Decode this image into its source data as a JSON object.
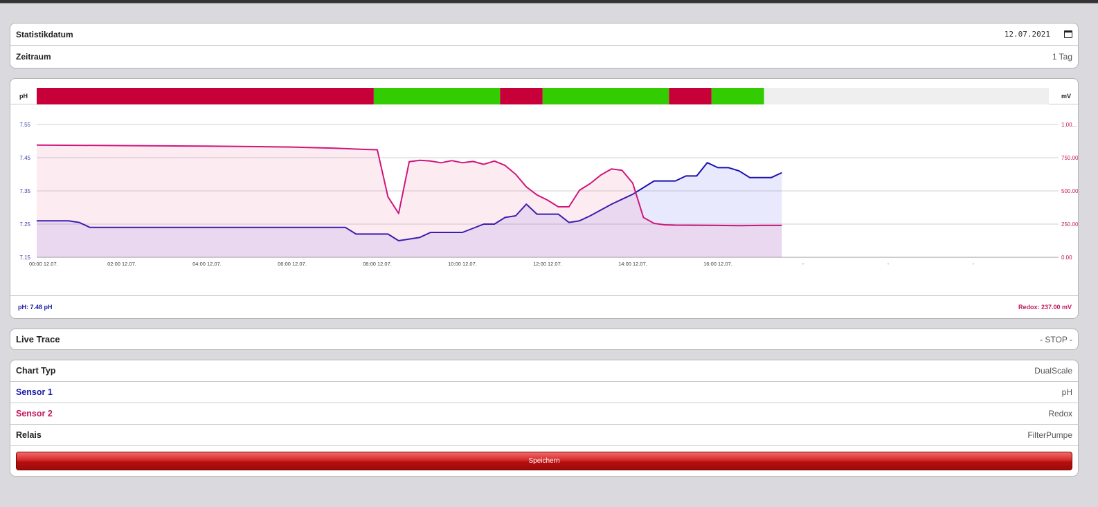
{
  "stats": {
    "date_label": "Statistikdatum",
    "date_value": "12.07.2021",
    "period_label": "Zeitraum",
    "period_value": "1 Tag"
  },
  "chart_header": {
    "left_unit": "pH",
    "right_unit": "mV"
  },
  "relay_segments": [
    {
      "state": "off",
      "color": "#c8003a",
      "from": "00:00",
      "to": "07:55"
    },
    {
      "state": "on",
      "color": "#33cc00",
      "from": "07:55",
      "to": "10:53"
    },
    {
      "state": "off",
      "color": "#c8003a",
      "from": "10:53",
      "to": "11:53"
    },
    {
      "state": "on",
      "color": "#33cc00",
      "from": "11:53",
      "to": "14:51"
    },
    {
      "state": "off",
      "color": "#c8003a",
      "from": "14:51",
      "to": "15:51"
    },
    {
      "state": "on",
      "color": "#33cc00",
      "from": "15:51",
      "to": "17:05"
    }
  ],
  "chart_data": {
    "type": "line",
    "title": "",
    "x_ticks": [
      "00:00 12.07.",
      "02:00 12.07.",
      "04:00 12.07.",
      "06:00 12.07.",
      "08:00 12.07.",
      "10:00 12.07.",
      "12:00 12.07.",
      "14:00 12.07.",
      "16:00 12.07.",
      "-",
      "-",
      "-"
    ],
    "y_left": {
      "label": "pH",
      "ticks": [
        "7.55",
        "7.45",
        "7.35",
        "7.25",
        "7.15"
      ],
      "range": [
        7.15,
        7.55
      ]
    },
    "y_right": {
      "label": "mV",
      "ticks": [
        "1,00...",
        "750.00",
        "500.00",
        "250.00",
        "0.00"
      ],
      "range": [
        0,
        1000
      ]
    },
    "x_range_hours": [
      0,
      24
    ],
    "series": [
      {
        "name": "pH",
        "axis": "left",
        "color": "#1a0fb0",
        "fill": "rgba(110,110,240,0.15)",
        "points": [
          [
            0,
            7.26
          ],
          [
            0.5,
            7.26
          ],
          [
            0.75,
            7.26
          ],
          [
            1.0,
            7.255
          ],
          [
            1.25,
            7.24
          ],
          [
            2,
            7.24
          ],
          [
            4,
            7.24
          ],
          [
            6,
            7.24
          ],
          [
            7.25,
            7.24
          ],
          [
            7.5,
            7.22
          ],
          [
            8.25,
            7.22
          ],
          [
            8.5,
            7.2
          ],
          [
            9.0,
            7.21
          ],
          [
            9.25,
            7.225
          ],
          [
            10,
            7.225
          ],
          [
            10.5,
            7.25
          ],
          [
            10.75,
            7.25
          ],
          [
            11.0,
            7.27
          ],
          [
            11.25,
            7.275
          ],
          [
            11.5,
            7.31
          ],
          [
            11.75,
            7.28
          ],
          [
            12.25,
            7.28
          ],
          [
            12.5,
            7.255
          ],
          [
            12.75,
            7.26
          ],
          [
            13.0,
            7.275
          ],
          [
            13.5,
            7.31
          ],
          [
            14.0,
            7.34
          ],
          [
            14.5,
            7.38
          ],
          [
            15.0,
            7.38
          ],
          [
            15.25,
            7.395
          ],
          [
            15.5,
            7.395
          ],
          [
            15.75,
            7.435
          ],
          [
            16.0,
            7.42
          ],
          [
            16.25,
            7.42
          ],
          [
            16.5,
            7.41
          ],
          [
            16.75,
            7.39
          ],
          [
            17.0,
            7.39
          ],
          [
            17.25,
            7.39
          ],
          [
            17.5,
            7.405
          ]
        ]
      },
      {
        "name": "Redox",
        "axis": "right",
        "color": "#d0157a",
        "fill": "rgba(240,120,170,0.15)",
        "points": [
          [
            0,
            845
          ],
          [
            1,
            843
          ],
          [
            2,
            841
          ],
          [
            3,
            839
          ],
          [
            4,
            837
          ],
          [
            5,
            834
          ],
          [
            6,
            830
          ],
          [
            7,
            822
          ],
          [
            7.75,
            812
          ],
          [
            8.0,
            810
          ],
          [
            8.25,
            455
          ],
          [
            8.5,
            330
          ],
          [
            8.75,
            720
          ],
          [
            9.0,
            730
          ],
          [
            9.25,
            725
          ],
          [
            9.5,
            712
          ],
          [
            9.75,
            728
          ],
          [
            10.0,
            712
          ],
          [
            10.25,
            722
          ],
          [
            10.5,
            700
          ],
          [
            10.75,
            725
          ],
          [
            11.0,
            692
          ],
          [
            11.25,
            625
          ],
          [
            11.5,
            530
          ],
          [
            11.75,
            470
          ],
          [
            12.0,
            430
          ],
          [
            12.25,
            380
          ],
          [
            12.5,
            380
          ],
          [
            12.75,
            505
          ],
          [
            13.0,
            555
          ],
          [
            13.25,
            620
          ],
          [
            13.5,
            665
          ],
          [
            13.75,
            655
          ],
          [
            14.0,
            558
          ],
          [
            14.25,
            300
          ],
          [
            14.5,
            255
          ],
          [
            14.75,
            245
          ],
          [
            15.0,
            242
          ],
          [
            16.0,
            240
          ],
          [
            16.5,
            238
          ],
          [
            17.0,
            240
          ],
          [
            17.5,
            240
          ]
        ]
      }
    ]
  },
  "footer": {
    "ph_readout": "pH: 7.48 pH",
    "redox_readout": "Redox: 237.00 mV"
  },
  "live_trace": {
    "label": "Live Trace",
    "value": "- STOP -"
  },
  "settings": {
    "chart_type_label": "Chart Typ",
    "chart_type_value": "DualScale",
    "sensor1_label": "Sensor 1",
    "sensor1_value": "pH",
    "sensor2_label": "Sensor 2",
    "sensor2_value": "Redox",
    "relay_label": "Relais",
    "relay_value": "FilterPumpe",
    "save_label": "Speichern"
  }
}
